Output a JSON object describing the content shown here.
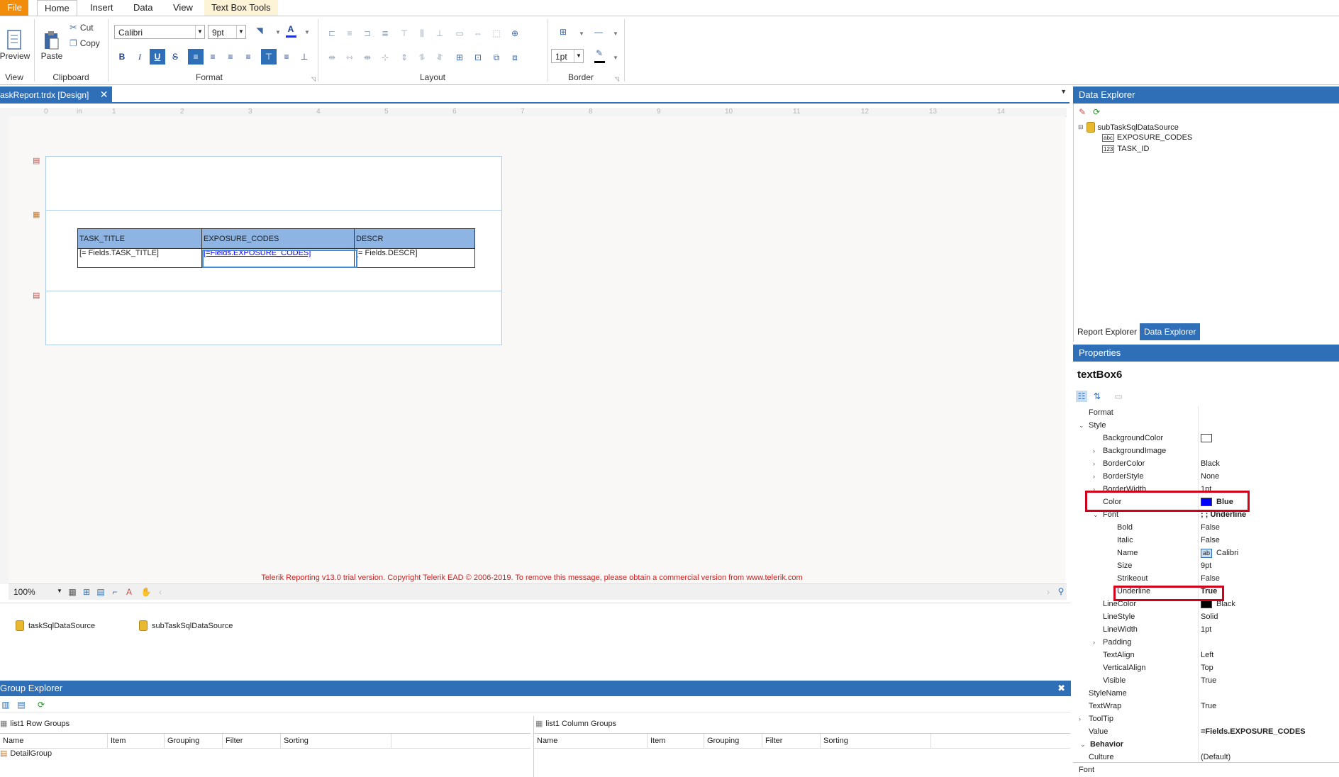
{
  "ribbon": {
    "tabs": [
      "File",
      "Home",
      "Insert",
      "Data",
      "View",
      "Text Box Tools"
    ],
    "groups": {
      "view": "View",
      "clipboard": "Clipboard",
      "format": "Format",
      "layout": "Layout",
      "border": "Border"
    },
    "preview_label": "Preview",
    "paste_label": "Paste",
    "cut_label": "Cut",
    "copy_label": "Copy",
    "font_name": "Calibri",
    "font_size": "9pt",
    "border_width": "1pt",
    "bold": "B",
    "italic": "I",
    "underline": "U",
    "strike": "S"
  },
  "document": {
    "tab_title": "askReport.trdx [Design]",
    "close": "✕"
  },
  "ruler": [
    "0",
    "in",
    "1",
    "2",
    "3",
    "4",
    "5",
    "6",
    "7",
    "8",
    "9",
    "10",
    "11",
    "12",
    "13",
    "14"
  ],
  "report_table": {
    "headers": [
      "TASK_TITLE",
      "EXPOSURE_CODES",
      "DESCR"
    ],
    "row": [
      "[= Fields.TASK_TITLE]",
      "[=Fields.EXPOSURE_CODES]",
      "[= Fields.DESCR]"
    ],
    "selected_color": "#0000ff"
  },
  "trial_notice": "Telerik Reporting v13.0 trial version. Copyright Telerik EAD © 2006-2019. To remove this message, please obtain a commercial version from www.telerik.com",
  "zoom": "100%",
  "data_sources": [
    "taskSqlDataSource",
    "subTaskSqlDataSource"
  ],
  "group_explorer": {
    "title": "Group Explorer",
    "row_groups_label": "list1 Row Groups",
    "column_groups_label": "list1 Column Groups",
    "columns": [
      "Name",
      "Item",
      "Grouping",
      "Filter",
      "Sorting"
    ],
    "row_groups": [
      "DetailGroup"
    ]
  },
  "data_explorer": {
    "title": "Data Explorer",
    "source": "subTaskSqlDataSource",
    "fields": [
      {
        "name": "EXPOSURE_CODES",
        "type": "abc"
      },
      {
        "name": "TASK_ID",
        "type": "123"
      }
    ],
    "tabs": [
      "Report Explorer",
      "Data Explorer"
    ]
  },
  "properties": {
    "title": "Properties",
    "object": "textBox6",
    "footer": "Font",
    "rows": [
      {
        "name": "Format",
        "value": "",
        "indent": 0,
        "expander": ""
      },
      {
        "name": "Style",
        "value": "",
        "indent": 0,
        "expander": "v"
      },
      {
        "name": "BackgroundColor",
        "value": "",
        "indent": 1,
        "expander": "",
        "swatch": "#ffffff"
      },
      {
        "name": "BackgroundImage",
        "value": "",
        "indent": 1,
        "expander": ">"
      },
      {
        "name": "BorderColor",
        "value": "Black",
        "indent": 1,
        "expander": ">"
      },
      {
        "name": "BorderStyle",
        "value": "None",
        "indent": 1,
        "expander": ">"
      },
      {
        "name": "BorderWidth",
        "value": "1pt",
        "indent": 1,
        "expander": ">"
      },
      {
        "name": "Color",
        "value": "Blue",
        "indent": 1,
        "expander": "",
        "swatch": "#0000ff",
        "bold": true
      },
      {
        "name": "Font",
        "value": "; ; Underline",
        "indent": 1,
        "expander": "v",
        "bold": true
      },
      {
        "name": "Bold",
        "value": "False",
        "indent": 2,
        "expander": ""
      },
      {
        "name": "Italic",
        "value": "False",
        "indent": 2,
        "expander": ""
      },
      {
        "name": "Name",
        "value": "Calibri",
        "indent": 2,
        "expander": "",
        "badge": "ab"
      },
      {
        "name": "Size",
        "value": "9pt",
        "indent": 2,
        "expander": ""
      },
      {
        "name": "Strikeout",
        "value": "False",
        "indent": 2,
        "expander": ""
      },
      {
        "name": "Underline",
        "value": "True",
        "indent": 2,
        "expander": "",
        "bold": true
      },
      {
        "name": "LineColor",
        "value": "Black",
        "indent": 1,
        "expander": "",
        "swatch": "#000000"
      },
      {
        "name": "LineStyle",
        "value": "Solid",
        "indent": 1,
        "expander": ""
      },
      {
        "name": "LineWidth",
        "value": "1pt",
        "indent": 1,
        "expander": ""
      },
      {
        "name": "Padding",
        "value": "",
        "indent": 1,
        "expander": ">"
      },
      {
        "name": "TextAlign",
        "value": "Left",
        "indent": 1,
        "expander": ""
      },
      {
        "name": "VerticalAlign",
        "value": "Top",
        "indent": 1,
        "expander": ""
      },
      {
        "name": "Visible",
        "value": "True",
        "indent": 1,
        "expander": ""
      },
      {
        "name": "StyleName",
        "value": "",
        "indent": 0,
        "expander": ""
      },
      {
        "name": "TextWrap",
        "value": "True",
        "indent": 0,
        "expander": ""
      },
      {
        "name": "ToolTip",
        "value": "",
        "indent": 0,
        "expander": ">"
      },
      {
        "name": "Value",
        "value": "=Fields.EXPOSURE_CODES",
        "indent": 0,
        "expander": "",
        "bold": true
      },
      {
        "name": "Behavior",
        "value": "",
        "indent": -1,
        "expander": "v",
        "bold": true
      },
      {
        "name": "Culture",
        "value": "(Default)",
        "indent": 0,
        "expander": ""
      }
    ]
  },
  "colors": {
    "accent": "#2f6fb7",
    "file_tab": "#f28c0b",
    "highlight": "#d0021b",
    "header_fill": "#8db4e2"
  }
}
